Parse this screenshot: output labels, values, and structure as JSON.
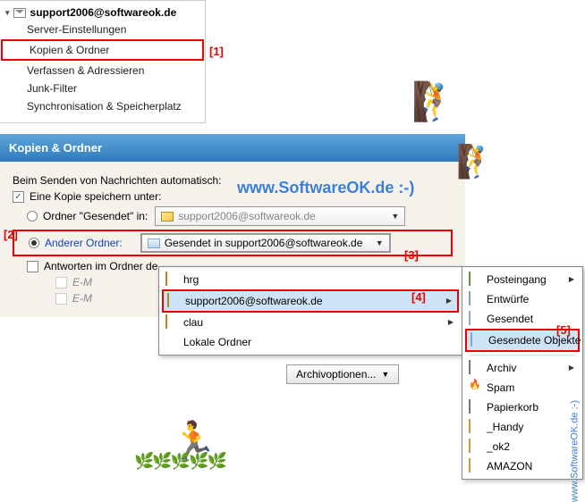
{
  "sidebar": {
    "account": "support2006@softwareok.de",
    "items": [
      "Server-Einstellungen",
      "Kopien & Ordner",
      "Verfassen & Adressieren",
      "Junk-Filter",
      "Synchronisation & Speicherplatz"
    ]
  },
  "annotations": {
    "a1": "[1]",
    "a2": "[2]",
    "a3": "[3]",
    "a4": "[4]",
    "a5": "[5]"
  },
  "panel": {
    "title": "Kopien & Ordner",
    "intro": "Beim Senden von Nachrichten automatisch:",
    "save_copy": "Eine Kopie speichern unter:",
    "radio_sent_in": "Ordner \"Gesendet\" in:",
    "radio_other": "Anderer Ordner:",
    "account_display": "support2006@softwareok.de",
    "other_folder_display": "Gesendet in support2006@softwareok.de",
    "reply_in_folder": "Antworten im Ordner de",
    "email_dim1": "E-M",
    "email_dim2": "E-M",
    "archive_btn": "Archivoptionen..."
  },
  "menu1": {
    "items": [
      {
        "label": "hrg",
        "sub": false
      },
      {
        "label": "support2006@softwareok.de",
        "sub": true,
        "highlight": true
      },
      {
        "label": "clau",
        "sub": true
      },
      {
        "label": "Lokale Ordner",
        "sub": false
      }
    ]
  },
  "menu2": {
    "items": [
      {
        "label": "Posteingang",
        "icon": "inbox",
        "sub": true
      },
      {
        "label": "Entwürfe",
        "icon": "draft",
        "sub": false
      },
      {
        "label": "Gesendet",
        "icon": "sent",
        "sub": false
      },
      {
        "label": "Gesendete Objekte",
        "icon": "folder",
        "sub": false,
        "highlight": true
      },
      {
        "label": "Archiv",
        "icon": "archive",
        "sub": true,
        "sep_before": true
      },
      {
        "label": "Spam",
        "icon": "spam",
        "sub": false
      },
      {
        "label": "Papierkorb",
        "icon": "trash",
        "sub": false
      },
      {
        "label": "_Handy",
        "icon": "folder-amazon",
        "sub": false
      },
      {
        "label": "_ok2",
        "icon": "folder-amazon",
        "sub": false
      },
      {
        "label": "AMAZON",
        "icon": "folder-amazon",
        "sub": false
      }
    ]
  },
  "watermark": "www.SoftwareOK.de :-)",
  "watermark_side": "www.SoftwareOK.de :-)"
}
